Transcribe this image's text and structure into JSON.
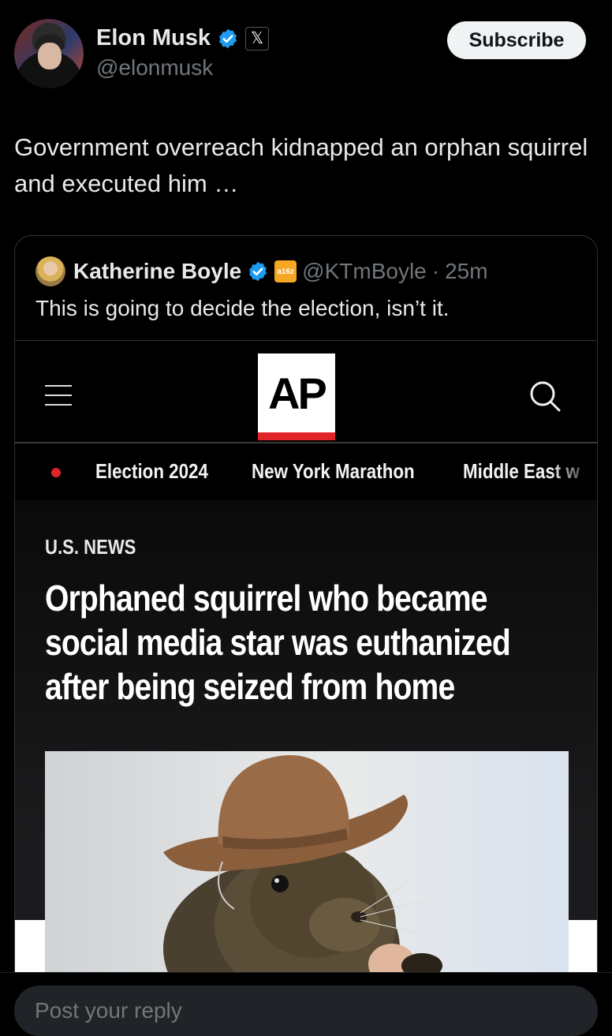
{
  "author": {
    "name": "Elon Musk",
    "handle": "@elonmusk",
    "badge_color": "#1d9bf0",
    "platform_icon": "x-logo-icon"
  },
  "subscribe_label": "Subscribe",
  "tweet_text": "Government overreach kidnapped an orphan squirrel and executed him …",
  "quote": {
    "name": "Katherine Boyle",
    "affiliate_badge": "a16z",
    "handle": "@KTmBoyle",
    "separator": "·",
    "time": "25m",
    "text": "This is going to decide the election, isn’t it."
  },
  "ap": {
    "logo": "AP",
    "nav_items": [
      "Election 2024",
      "New York Marathon",
      "Middle East w"
    ],
    "section": "U.S. NEWS",
    "headline_lines": [
      "Orphaned squirrel who became",
      "social media star was euthanized",
      "after being seized from home"
    ],
    "accent": "#e0242a"
  },
  "reply_placeholder": "Post your reply"
}
